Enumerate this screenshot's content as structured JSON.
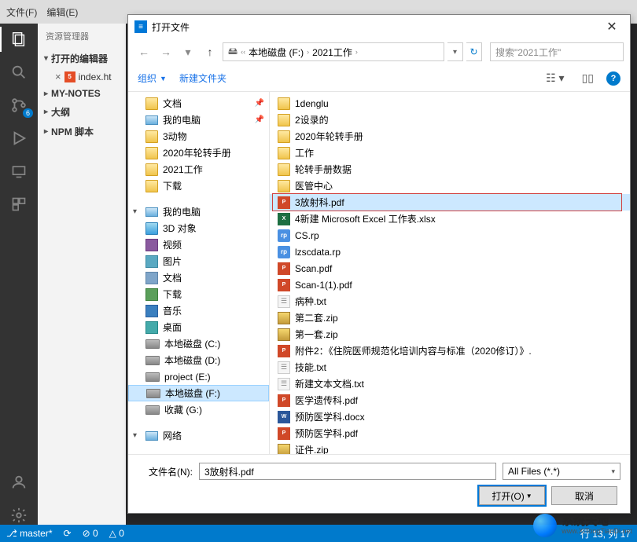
{
  "vscode": {
    "menus": [
      "文件(F)",
      "编辑(E)"
    ],
    "explorer_title": "资源管理器",
    "open_editors_label": "打开的编辑器",
    "open_file": "index.ht",
    "sections": [
      "MY-NOTES",
      "大纲",
      "NPM 脚本"
    ],
    "scm_badge": "6",
    "statusbar": {
      "branch": "master*",
      "sync": "⟳",
      "errors": "⊘ 0",
      "warnings": "△ 0",
      "cursor": "行 13, 列 17"
    }
  },
  "dialog": {
    "title": "打开文件",
    "breadcrumb": {
      "drive": "本地磁盘 (F:)",
      "folder": "2021工作"
    },
    "search_placeholder": "搜索\"2021工作\"",
    "toolbar": {
      "organize": "组织",
      "new_folder": "新建文件夹"
    },
    "nav_tree": [
      {
        "label": "文档",
        "kind": "folder",
        "indent": 1,
        "pinned": true
      },
      {
        "label": "我的电脑",
        "kind": "pc",
        "indent": 1,
        "pinned": true
      },
      {
        "label": "3动物",
        "kind": "folder",
        "indent": 1
      },
      {
        "label": "2020年轮转手册",
        "kind": "folder",
        "indent": 1
      },
      {
        "label": "2021工作",
        "kind": "folder",
        "indent": 1
      },
      {
        "label": "下载",
        "kind": "folder",
        "indent": 1
      },
      {
        "label": "我的电脑",
        "kind": "pc",
        "indent": 0,
        "section": true
      },
      {
        "label": "3D 对象",
        "kind": "3d",
        "indent": 1
      },
      {
        "label": "视频",
        "kind": "video",
        "indent": 1
      },
      {
        "label": "图片",
        "kind": "pic",
        "indent": 1
      },
      {
        "label": "文档",
        "kind": "doc",
        "indent": 1
      },
      {
        "label": "下载",
        "kind": "down",
        "indent": 1
      },
      {
        "label": "音乐",
        "kind": "music",
        "indent": 1
      },
      {
        "label": "桌面",
        "kind": "desktop",
        "indent": 1
      },
      {
        "label": "本地磁盘 (C:)",
        "kind": "drive",
        "indent": 1
      },
      {
        "label": "本地磁盘 (D:)",
        "kind": "drive",
        "indent": 1
      },
      {
        "label": "project (E:)",
        "kind": "drive",
        "indent": 1
      },
      {
        "label": "本地磁盘 (F:)",
        "kind": "drive",
        "indent": 1,
        "selected": true
      },
      {
        "label": "收藏 (G:)",
        "kind": "drive",
        "indent": 1
      },
      {
        "label": "网络",
        "kind": "network",
        "indent": 0,
        "section": true
      }
    ],
    "files": [
      {
        "name": "1denglu",
        "kind": "folder"
      },
      {
        "name": "2设录的",
        "kind": "folder"
      },
      {
        "name": "2020年轮转手册",
        "kind": "folder"
      },
      {
        "name": "工作",
        "kind": "folder"
      },
      {
        "name": "轮转手册数据",
        "kind": "folder"
      },
      {
        "name": "医管中心",
        "kind": "folder"
      },
      {
        "name": "3放射科.pdf",
        "kind": "pdf",
        "selected": true,
        "highlighted": true
      },
      {
        "name": "4新建 Microsoft Excel 工作表.xlsx",
        "kind": "xlsx"
      },
      {
        "name": "CS.rp",
        "kind": "rp"
      },
      {
        "name": "lzscdata.rp",
        "kind": "rp"
      },
      {
        "name": "Scan.pdf",
        "kind": "pdf"
      },
      {
        "name": "Scan-1(1).pdf",
        "kind": "pdf"
      },
      {
        "name": "病种.txt",
        "kind": "txt"
      },
      {
        "name": "第二套.zip",
        "kind": "zip"
      },
      {
        "name": "第一套.zip",
        "kind": "zip"
      },
      {
        "name": "附件2：《住院医师规范化培训内容与标准（2020修订）》.",
        "kind": "pdf"
      },
      {
        "name": "技能.txt",
        "kind": "txt"
      },
      {
        "name": "新建文本文档.txt",
        "kind": "txt"
      },
      {
        "name": "医学遗传科.pdf",
        "kind": "pdf"
      },
      {
        "name": "预防医学科.docx",
        "kind": "docx"
      },
      {
        "name": "预防医学科.pdf",
        "kind": "pdf"
      },
      {
        "name": "证件.zip",
        "kind": "zip"
      }
    ],
    "filename_label": "文件名(N):",
    "filename_value": "3放射科.pdf",
    "filter_label": "All Files (*.*)",
    "open_btn": "打开(O)",
    "cancel_btn": "取消"
  },
  "watermark": {
    "big": "系统天地",
    "small": "www.XiTongTianDi.net"
  }
}
